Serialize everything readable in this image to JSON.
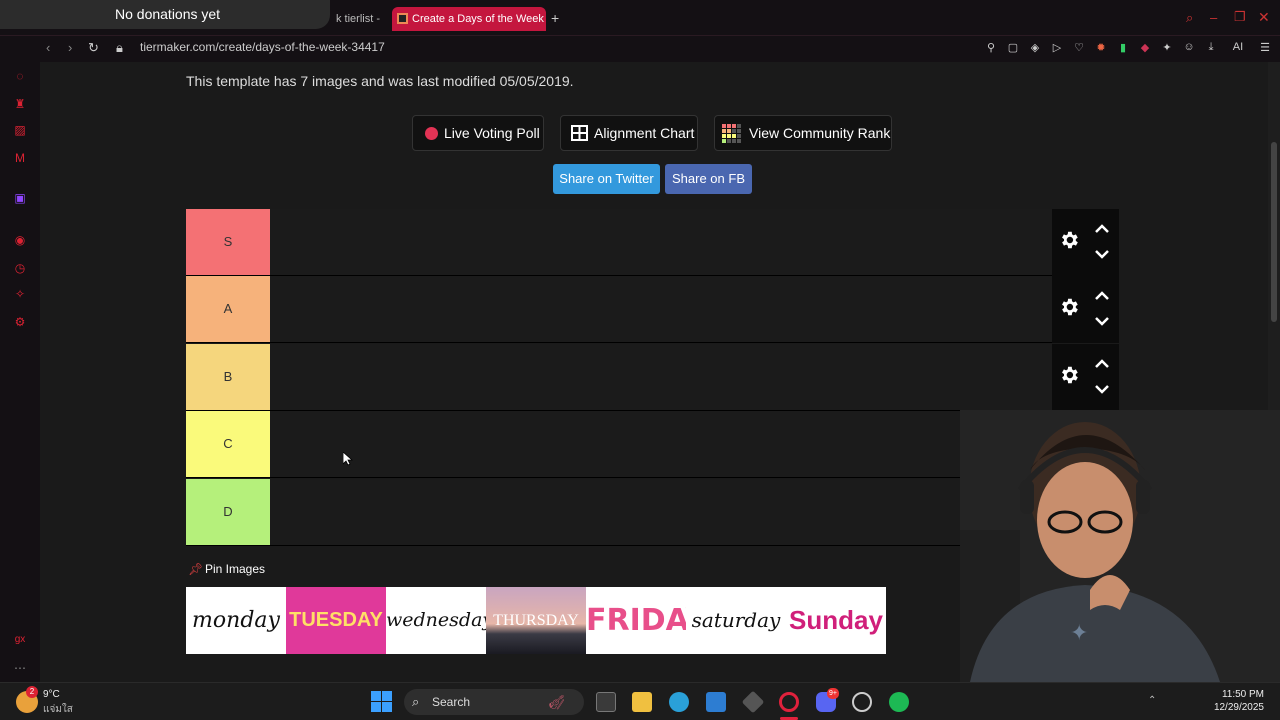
{
  "donation": {
    "text": "No donations yet"
  },
  "tabs": [
    {
      "label": "k tierlist -"
    },
    {
      "label": "Create a Days of the Week"
    }
  ],
  "address": {
    "url": "tiermaker.com/create/days-of-the-week-34417"
  },
  "extensions": {
    "ai_label": "AI"
  },
  "page": {
    "template_info": "This template has 7 images and was last modified 05/05/2019.",
    "buttons": {
      "live_voting": "Live Voting Poll",
      "alignment": "Alignment Chart",
      "community_rank": "View Community Rank"
    },
    "share": {
      "twitter": "Share on Twitter",
      "fb": "Share on FB"
    },
    "tiers": [
      {
        "label": "S",
        "color": "#f47174"
      },
      {
        "label": "A",
        "color": "#f6b27b"
      },
      {
        "label": "B",
        "color": "#f5d67d"
      },
      {
        "label": "C",
        "color": "#fafa7b"
      },
      {
        "label": "D",
        "color": "#b5f07b"
      }
    ],
    "pin_images_label": "Pin Images",
    "days": [
      {
        "label": "monday",
        "bg": "#ffffff",
        "color": "#111111"
      },
      {
        "label": "TUESDAY",
        "bg": "#e0399a",
        "color": "#ffe066"
      },
      {
        "label": "wednesday",
        "bg": "#ffffff",
        "color": "#111111"
      },
      {
        "label": "THURSDAY",
        "bg": "#c99aa6",
        "color": "#ffffff"
      },
      {
        "label": "FRIDAY",
        "bg": "#ffffff",
        "color": "#e84f8a"
      },
      {
        "label": "saturday",
        "bg": "#ffffff",
        "color": "#111111"
      },
      {
        "label": "Sunday",
        "bg": "#ffffff",
        "color": "#d01f7a"
      }
    ]
  },
  "taskbar": {
    "weather_badge": "2",
    "weather_temp": "9°C",
    "weather_desc": "แจ่มใส",
    "search_label": "Search",
    "discord_badge": "9+",
    "time": "11:50 PM",
    "date": "12/29/2025"
  }
}
